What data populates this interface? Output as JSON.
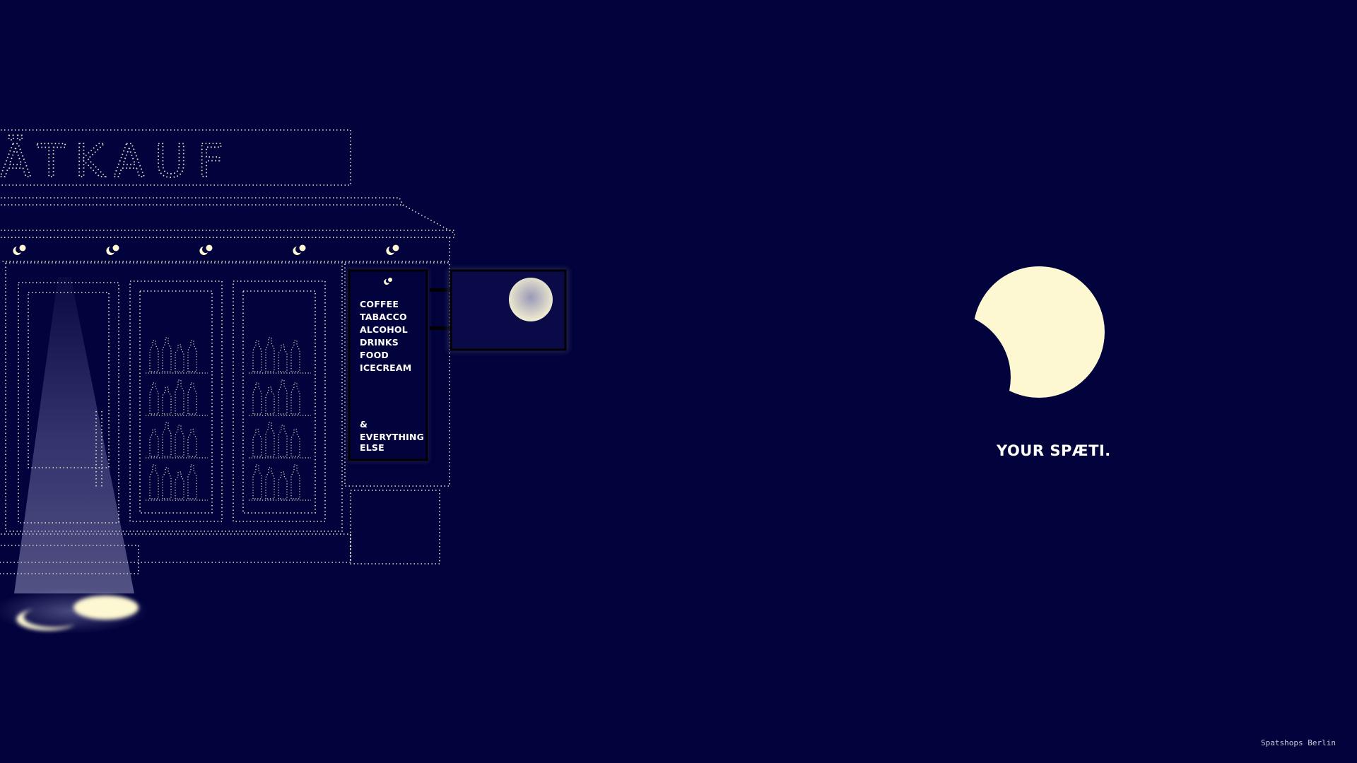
{
  "storefront": {
    "store_name": "ÄTKAUF",
    "sign_items": [
      "COFFEE",
      "TABACCO",
      "ALCOHOL",
      "DRINKS",
      "FOOD",
      "ICECREAM"
    ],
    "sign_footer": [
      "&",
      "EVERYTHING",
      "ELSE"
    ]
  },
  "brand": {
    "tagline": "YOUR SPÆTI."
  },
  "footer": {
    "credit": "Spatshops Berlin"
  },
  "colors": {
    "background": "#02023c",
    "moon": "#fdf7d2",
    "outline": "#e8e6c8",
    "text": "#ffffff"
  },
  "icons": [
    "crescent-moon-icon",
    "full-moon-icon",
    "bottle-icon",
    "lamp-icon"
  ]
}
